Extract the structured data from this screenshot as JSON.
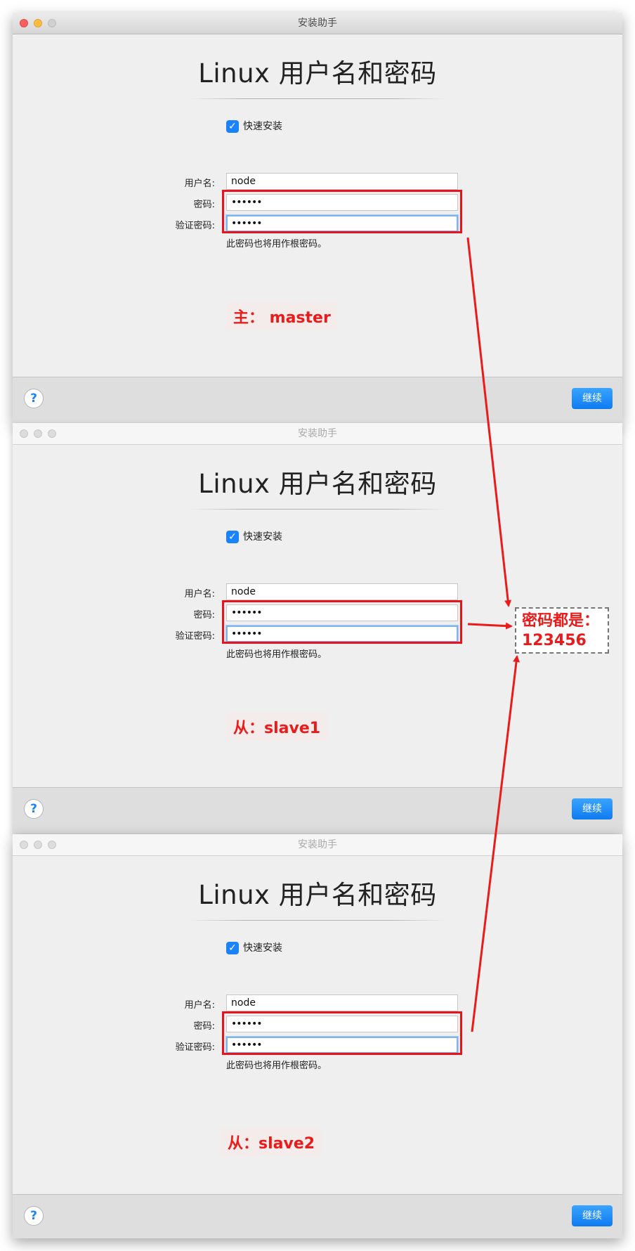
{
  "window_title": "安装助手",
  "heading": "Linux 用户名和密码",
  "quick_install_label": "快速安装",
  "labels": {
    "username": "用户名:",
    "password": "密码:",
    "verify_password": "验证密码:"
  },
  "values": {
    "username": "node",
    "password": "••••••",
    "verify_password": "••••••"
  },
  "hint": "此密码也将用作根密码。",
  "help_label": "?",
  "continue_label": "继续",
  "roles": {
    "master": "主： master",
    "slave1": "从：slave1",
    "slave2": "从：slave2"
  },
  "note": {
    "line1": "密码都是：",
    "line2": "123456"
  },
  "colors": {
    "annotation_red": "#ea1b1b",
    "accent_blue": "#1a82fb"
  }
}
